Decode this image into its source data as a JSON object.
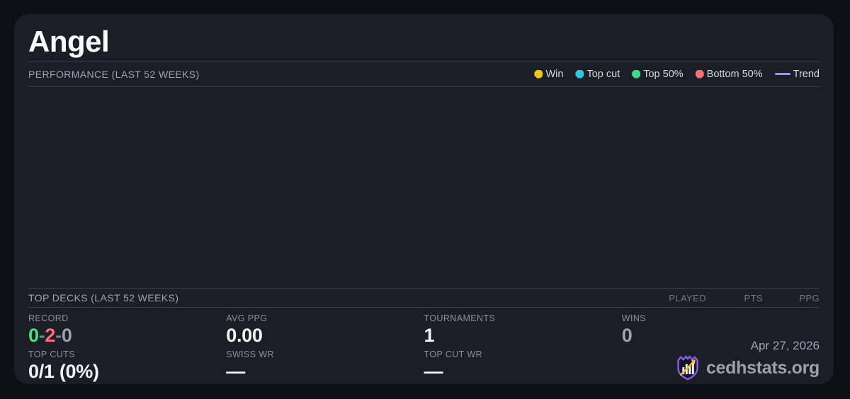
{
  "card": {
    "title": "Angel"
  },
  "performance": {
    "header": "PERFORMANCE (LAST 52 WEEKS)",
    "legend": [
      {
        "label": "Win",
        "color": "#f2c513",
        "swatch": "dot"
      },
      {
        "label": "Top cut",
        "color": "#2bc8e4",
        "swatch": "dot"
      },
      {
        "label": "Top 50%",
        "color": "#3ed98c",
        "swatch": "dot"
      },
      {
        "label": "Bottom 50%",
        "color": "#f87171",
        "swatch": "dot"
      },
      {
        "label": "Trend",
        "color": "#a78bfa",
        "swatch": "line"
      }
    ],
    "chart_empty": true
  },
  "top_decks": {
    "header": "TOP DECKS (LAST 52 WEEKS)",
    "columns": [
      "PLAYED",
      "PTS",
      "PPG"
    ],
    "rows": []
  },
  "stats": {
    "record": {
      "label": "RECORD",
      "wins": "0",
      "losses": "2",
      "draws": "0",
      "separator": "-"
    },
    "top_cuts": {
      "label": "TOP CUTS",
      "value": "0/1 (0%)"
    },
    "avg_ppg": {
      "label": "AVG PPG",
      "value": "0.00"
    },
    "swiss_wr": {
      "label": "SWISS WR",
      "value": "—"
    },
    "tournaments": {
      "label": "TOURNAMENTS",
      "value": "1"
    },
    "top_cut_wr": {
      "label": "TOP CUT WR",
      "value": "—"
    },
    "wins": {
      "label": "WINS",
      "value": "0"
    }
  },
  "footer": {
    "date": "Apr 27, 2026",
    "site": "cedhstats.org"
  },
  "colors": {
    "page_bg": "#0e0f14",
    "card_bg": "#1b1e26",
    "divider": "#363c4b",
    "win_green": "#4ade80",
    "loss_red": "#f8717a",
    "muted_gray": "#9ca3af",
    "trend_purple": "#a78bfa",
    "logo_purple": "#8b5cf6",
    "logo_gold": "#fbbf24"
  }
}
